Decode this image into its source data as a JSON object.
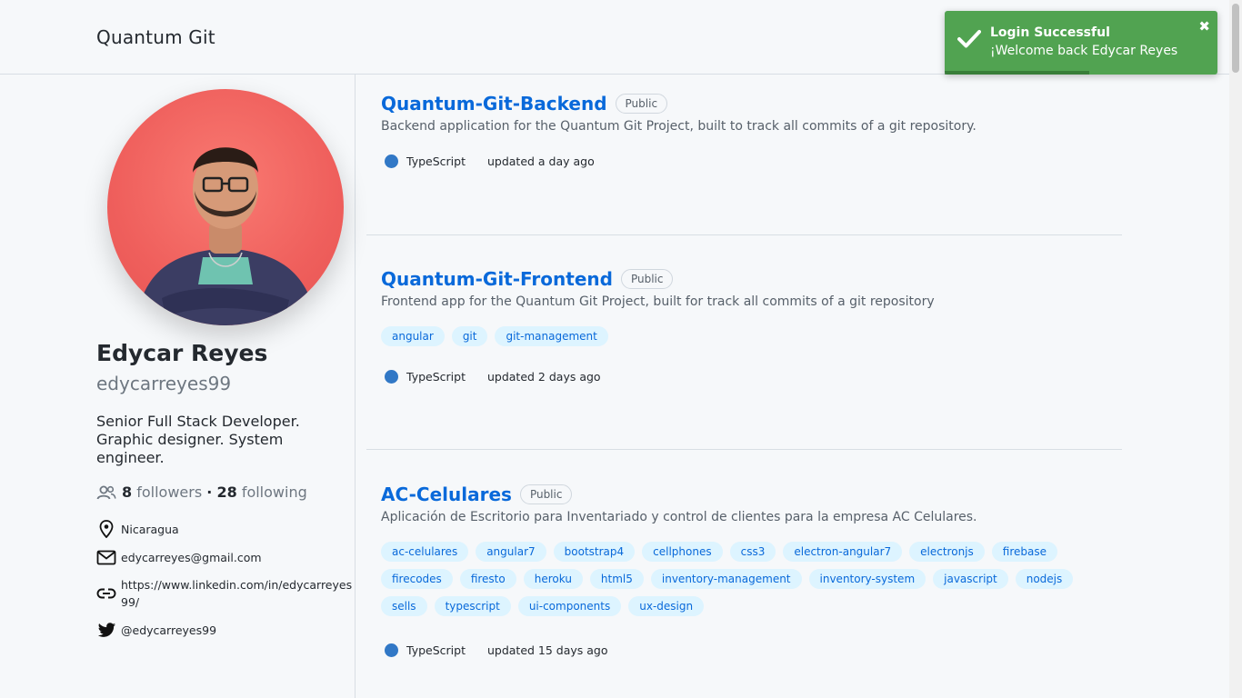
{
  "header": {
    "brand": "Quantum Git"
  },
  "profile": {
    "name": "Edycar Reyes",
    "username": "edycarreyes99",
    "bio": "Senior Full Stack Developer. Graphic designer. System engineer.",
    "followers_count": "8",
    "followers_label": "followers",
    "separator": "·",
    "following_count": "28",
    "following_label": "following",
    "location": "Nicaragua",
    "email": "edycarreyes@gmail.com",
    "website_line1": "https://www.linkedin.com/in/edycarreyes",
    "website_line2": "99/",
    "twitter": "@edycarreyes99"
  },
  "repos": [
    {
      "name": "Quantum-Git-Backend",
      "visibility": "Public",
      "description": "Backend application for the Quantum Git Project, built to track all commits of a git repository.",
      "topics": [],
      "language": "TypeScript",
      "language_color": "#3178c6",
      "updated": "updated a day ago"
    },
    {
      "name": "Quantum-Git-Frontend",
      "visibility": "Public",
      "description": "Frontend app for the Quantum Git Project, built for track all commits of a git repository",
      "topics": [
        "angular",
        "git",
        "git-management"
      ],
      "language": "TypeScript",
      "language_color": "#3178c6",
      "updated": "updated 2 days ago"
    },
    {
      "name": "AC-Celulares",
      "visibility": "Public",
      "description": "Aplicación de Escritorio para Inventariado y control de clientes para la empresa AC Celulares.",
      "topics": [
        "ac-celulares",
        "angular7",
        "bootstrap4",
        "cellphones",
        "css3",
        "electron-angular7",
        "electronjs",
        "firebase",
        "firecodes",
        "firesto",
        "heroku",
        "html5",
        "inventory-management",
        "inventory-system",
        "javascript",
        "nodejs",
        "sells",
        "typescript",
        "ui-components",
        "ux-design"
      ],
      "language": "TypeScript",
      "language_color": "#3178c6",
      "updated": "updated 15 days ago"
    }
  ],
  "toast": {
    "title": "Login Successful",
    "message": "¡Welcome back Edycar Reyes",
    "close": "✖",
    "progress_fraction": 0.53,
    "color": "#51a351"
  }
}
